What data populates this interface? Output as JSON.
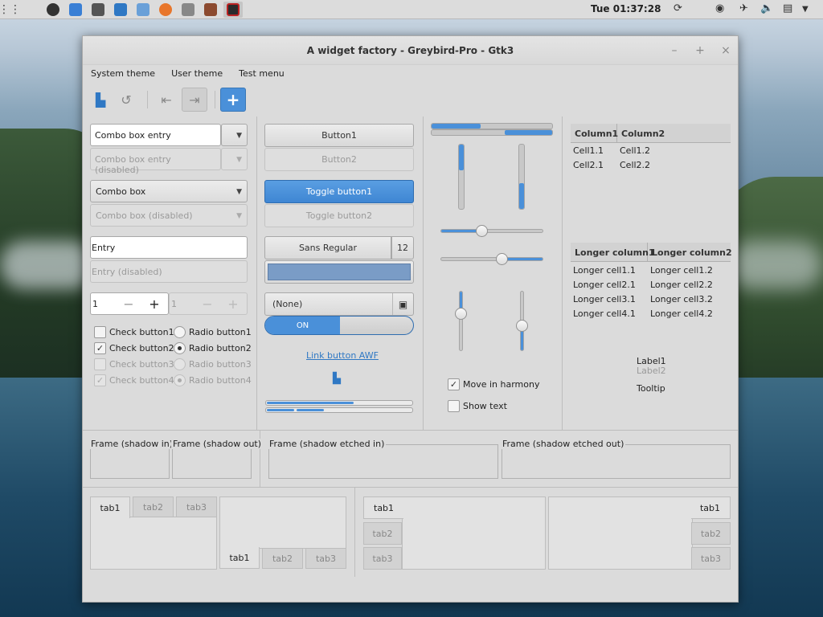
{
  "panel": {
    "apps_icon": "apps-grid-icon",
    "tasks": [
      "terminal",
      "files",
      "inkscape",
      "editor",
      "screenshot",
      "firefox",
      "settings",
      "image-viewer",
      "app"
    ],
    "clock": "Tue 01:37:28"
  },
  "window": {
    "title": "A widget factory - Greybird-Pro - Gtk3",
    "minimize": "–",
    "maximize": "+",
    "close": "×"
  },
  "menu": [
    "System theme",
    "User theme",
    "Test menu"
  ],
  "col1": {
    "combo_entry": "Combo box entry",
    "combo_entry_dis": "Combo box entry (disabled)",
    "combo": "Combo box",
    "combo_dis": "Combo box (disabled)",
    "entry": "Entry",
    "entry_dis": "Entry (disabled)",
    "spin": "1",
    "spin_dis": "1",
    "spin_minus": "−",
    "spin_plus": "+",
    "checks": [
      "Check button1",
      "Check button2",
      "Check button3",
      "Check button4"
    ],
    "radios": [
      "Radio button1",
      "Radio button2",
      "Radio button3",
      "Radio button4"
    ]
  },
  "col2": {
    "button1": "Button1",
    "button2": "Button2",
    "toggle1": "Toggle button1",
    "toggle2": "Toggle button2",
    "font": "Sans Regular",
    "font_size": "12",
    "file": "(None)",
    "switch": "ON",
    "link": "Link button AWF",
    "color": "#7a9cc6"
  },
  "col3": {
    "move_in_harmony": "Move in harmony",
    "show_text": "Show text",
    "hslider1": 0.3,
    "hslider2": 0.6,
    "vslider1": 0.4,
    "vslider2": 0.6
  },
  "col4": {
    "table1": {
      "headers": [
        "Column1",
        "Column2"
      ],
      "rows": [
        [
          "Cell1.1",
          "Cell1.2"
        ],
        [
          "Cell2.1",
          "Cell2.2"
        ]
      ]
    },
    "table2": {
      "headers": [
        "Longer column1",
        "Longer column2"
      ],
      "rows": [
        [
          "Longer cell1.1",
          "Longer cell1.2"
        ],
        [
          "Longer cell2.1",
          "Longer cell2.2"
        ],
        [
          "Longer cell3.1",
          "Longer cell3.2"
        ],
        [
          "Longer cell4.1",
          "Longer cell4.2"
        ]
      ]
    },
    "label1": "Label1",
    "label2": "Label2",
    "tooltip": "Tooltip"
  },
  "frames": [
    "Frame (shadow in)",
    "Frame (shadow out)",
    "Frame (shadow etched in)",
    "Frame (shadow etched out)"
  ],
  "tabs": [
    "tab1",
    "tab2",
    "tab3"
  ],
  "accent": "#4a90d9"
}
